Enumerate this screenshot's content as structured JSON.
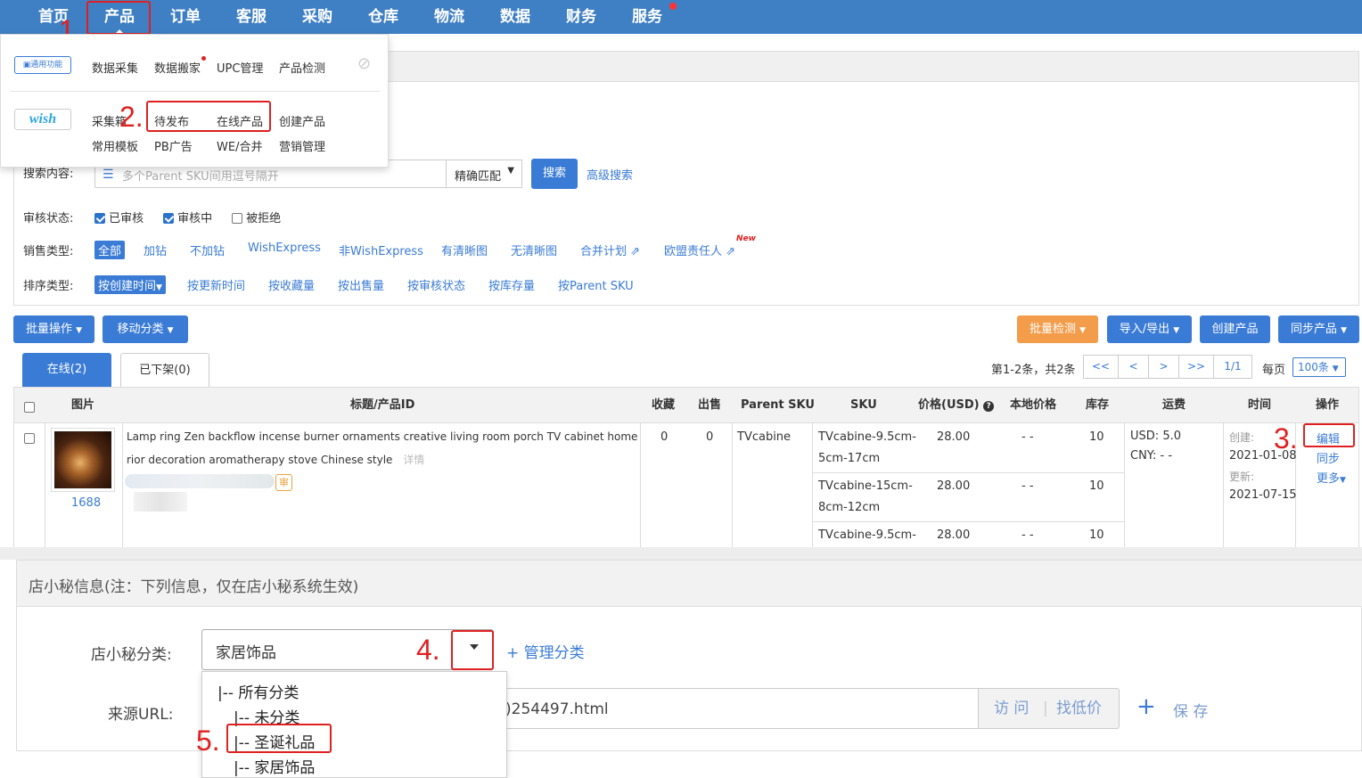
{
  "nav": {
    "items": [
      "首页",
      "产品",
      "订单",
      "客服",
      "采购",
      "仓库",
      "物流",
      "数据",
      "财务",
      "服务"
    ]
  },
  "menu": {
    "general_tag": "通用功能",
    "general_items": [
      "数据采集",
      "数据搬家",
      "UPC管理",
      "产品检测"
    ],
    "wish_logo": "wish",
    "wish_row1": [
      "采集箱",
      "待发布",
      "在线产品",
      "创建产品"
    ],
    "wish_row2": [
      "常用模板",
      "PB广告",
      "WE/合并",
      "营销管理"
    ]
  },
  "steps": [
    "1.",
    "2.",
    "3.",
    "4.",
    "5."
  ],
  "search": {
    "label": "搜索内容:",
    "placeholder": "多个Parent SKU间用逗号隔开",
    "match": "精确匹配",
    "search_btn": "搜索",
    "advanced": "高级搜索"
  },
  "filters": {
    "audit_label": "审核状态:",
    "audit_options": [
      "已审核",
      "审核中",
      "被拒绝"
    ],
    "sale_label": "销售类型:",
    "sale_options": [
      "全部",
      "加钻",
      "不加钻",
      "WishExpress",
      "非WishExpress",
      "有清晰图",
      "无清晰图",
      "合并计划",
      "欧盟责任人"
    ],
    "new_badge": "New",
    "sort_label": "排序类型:",
    "sort_options": [
      "按创建时间",
      "按更新时间",
      "按收藏量",
      "按出售量",
      "按审核状态",
      "按库存量",
      "按Parent SKU"
    ]
  },
  "toolbar": {
    "bulk": "批量操作",
    "move": "移动分类",
    "check": "批量检测",
    "import": "导入/导出",
    "create": "创建产品",
    "sync": "同步产品"
  },
  "tabs": {
    "online": "在线(2)",
    "offline": "已下架(0)"
  },
  "pager": {
    "summary": "第1-2条，共2条",
    "first": "<<",
    "prev": "<",
    "next": ">",
    "last": ">>",
    "page": "1/1",
    "per_page_label": "每页",
    "per_page": "100条"
  },
  "table": {
    "headers": [
      "图片",
      "标题/产品ID",
      "收藏",
      "出售",
      "Parent SKU",
      "SKU",
      "价格(USD)",
      "本地价格",
      "库存",
      "运费",
      "时间",
      "操作"
    ],
    "row": {
      "source": "1688",
      "title_line1": "Lamp ring Zen backflow incense burner ornaments creative living room porch TV cabinet home inte",
      "title_line2": "rior decoration aromatherapy stove Chinese style",
      "detail": "详情",
      "audit_badge": "审",
      "favorites": "0",
      "sold": "0",
      "parent_sku": "TVcabine",
      "skus": [
        {
          "sku1": "TVcabine-9.5cm-",
          "sku2": "5cm-17cm",
          "price": "28.00",
          "local": "- -",
          "stock": "10"
        },
        {
          "sku1": "TVcabine-15cm-",
          "sku2": "8cm-12cm",
          "price": "28.00",
          "local": "- -",
          "stock": "10"
        },
        {
          "sku1": "TVcabine-9.5cm-",
          "sku2": "",
          "price": "28.00",
          "local": "- -",
          "stock": "10"
        }
      ],
      "ship_usd_label": "USD:",
      "ship_usd": "5.0",
      "ship_cny_label": "CNY:",
      "ship_cny": "- -",
      "created_label": "创建:",
      "created": "2021-01-08",
      "updated_label": "更新:",
      "updated": "2021-07-15",
      "actions": [
        "编辑",
        "同步",
        "更多"
      ]
    }
  },
  "dxm": {
    "header": "店小秘信息",
    "note": "(注：下列信息，仅在店小秘系统生效)",
    "category_label": "店小秘分类:",
    "category_value": "家居饰品",
    "manage": "+ 管理分类",
    "url_label": "来源URL:",
    "url_value": ")254497.html",
    "visit": "访 问",
    "find_price": "找低价",
    "save": "保 存",
    "dropdown": [
      "|-- 所有分类",
      "|-- 未分类",
      "|-- 圣诞礼品",
      "|-- 家居饰品"
    ]
  }
}
